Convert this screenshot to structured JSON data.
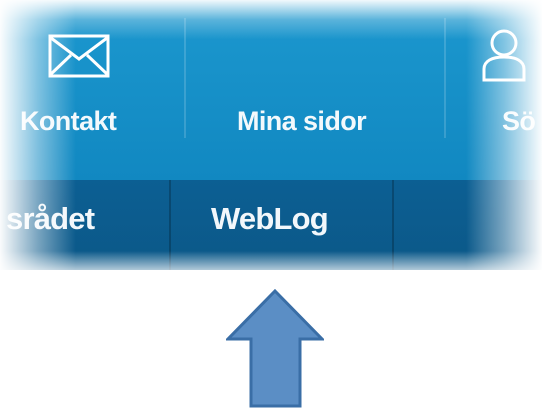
{
  "top_navigation": {
    "items": [
      {
        "label": "Kontakt",
        "icon": "envelope-icon"
      },
      {
        "label": "Mina sidor",
        "icon": "user-icon"
      },
      {
        "label": "Sö",
        "icon": "search-icon"
      }
    ]
  },
  "secondary_navigation": {
    "items": [
      {
        "label": "srådet"
      },
      {
        "label": "WebLog"
      }
    ]
  },
  "annotation": {
    "type": "up-arrow"
  },
  "colors": {
    "top_bar": "#1992ca",
    "secondary_bar": "#0c5f93",
    "arrow_fill": "#5b8ec5",
    "arrow_stroke": "#3a6ea6",
    "text": "#ffffff"
  }
}
